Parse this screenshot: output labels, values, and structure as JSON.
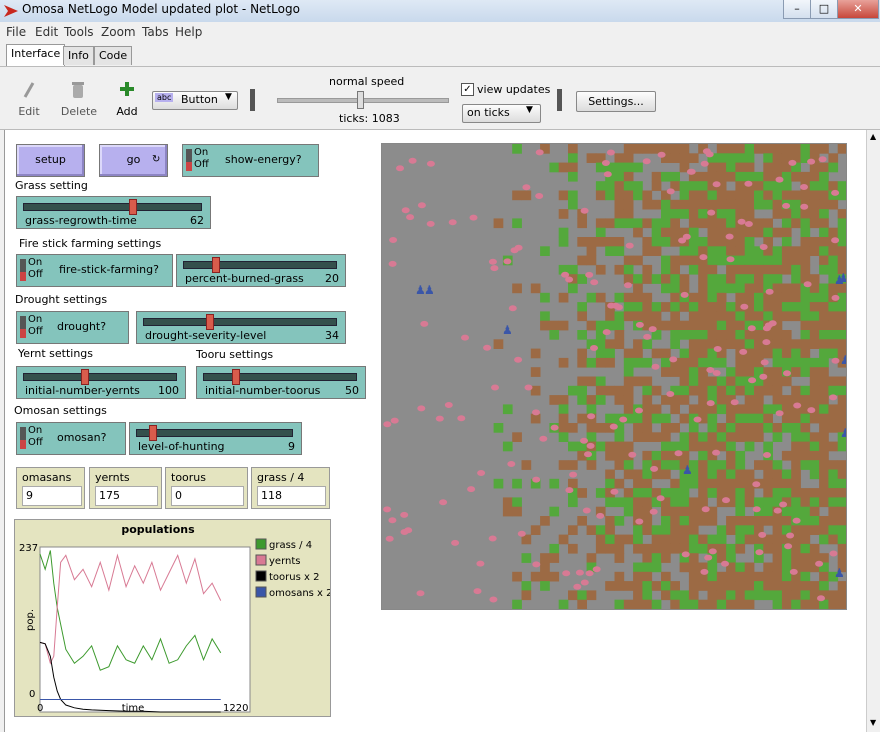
{
  "window": {
    "title": "Omosa NetLogo Model updated plot - NetLogo"
  },
  "menu": [
    "File",
    "Edit",
    "Tools",
    "Zoom",
    "Tabs",
    "Help"
  ],
  "tabs": [
    "Interface",
    "Info",
    "Code"
  ],
  "toolbar": {
    "edit": "Edit",
    "delete": "Delete",
    "add": "Add",
    "widget_type": "Button",
    "speed_label": "normal speed",
    "ticks": "ticks: 1083",
    "view_updates": "view updates",
    "update_mode": "on ticks",
    "settings": "Settings..."
  },
  "buttons": {
    "setup": "setup",
    "go": "go"
  },
  "switches": {
    "on": "On",
    "off": "Off",
    "show_energy": "show-energy?",
    "fire_stick": "fire-stick-farming?",
    "drought": "drought?",
    "omosan": "omosan?"
  },
  "notes": {
    "grass": "Grass setting",
    "fire": "Fire stick farming settings",
    "drought": "Drought settings",
    "yernt": "Yernt settings",
    "tooru": "Tooru settings",
    "omosan": "Omosan settings"
  },
  "sliders": {
    "grass_regrowth": {
      "label": "grass-regrowth-time",
      "value": "62",
      "fraction": 0.62
    },
    "percent_burned": {
      "label": "percent-burned-grass",
      "value": "20",
      "fraction": 0.2
    },
    "drought_severity": {
      "label": "drought-severity-level",
      "value": "34",
      "fraction": 0.34
    },
    "yernts": {
      "label": "initial-number-yernts",
      "value": "100",
      "fraction": 0.4
    },
    "toorus": {
      "label": "initial-number-toorus",
      "value": "50",
      "fraction": 0.2
    },
    "hunting": {
      "label": "level-of-hunting",
      "value": "9",
      "fraction": 0.09
    }
  },
  "monitors": [
    {
      "label": "omasans",
      "value": "9"
    },
    {
      "label": "yernts",
      "value": "175"
    },
    {
      "label": "toorus",
      "value": "0"
    },
    {
      "label": "grass / 4",
      "value": "118"
    }
  ],
  "colors": {
    "grass": "#54a83c",
    "yernts": "#d87a94",
    "toorus": "#000000",
    "omosans": "#3a56a8",
    "dirt": "#9c6a44",
    "ground": "#8c8c8c"
  },
  "chart_data": {
    "type": "line",
    "title": "populations",
    "xlabel": "time",
    "ylabel": "pop.",
    "xlim": [
      0,
      1220
    ],
    "ylim": [
      0,
      237
    ],
    "x_tick_labels": [
      "0",
      "1220"
    ],
    "y_tick_labels": [
      "0",
      "237"
    ],
    "legend_position": "right",
    "series": [
      {
        "name": "grass / 4",
        "color": "#3d9a2e",
        "x": [
          0,
          30,
          60,
          80,
          100,
          150,
          200,
          250,
          300,
          350,
          400,
          450,
          500,
          550,
          600,
          650,
          700,
          750,
          800,
          850,
          900,
          950,
          1000,
          1050
        ],
        "y": [
          227,
          205,
          232,
          185,
          150,
          90,
          70,
          80,
          95,
          60,
          65,
          95,
          75,
          70,
          95,
          75,
          105,
          70,
          75,
          95,
          110,
          75,
          105,
          85
        ]
      },
      {
        "name": "yernts",
        "color": "#d87a94",
        "x": [
          0,
          30,
          60,
          80,
          100,
          120,
          150,
          200,
          250,
          300,
          350,
          400,
          450,
          500,
          550,
          600,
          650,
          700,
          750,
          800,
          850,
          900,
          950,
          1000,
          1050
        ],
        "y": [
          100,
          98,
          70,
          80,
          150,
          215,
          225,
          190,
          205,
          180,
          215,
          175,
          225,
          180,
          210,
          185,
          215,
          175,
          200,
          225,
          185,
          220,
          170,
          185,
          160
        ]
      },
      {
        "name": "toorus x 2",
        "color": "#000000",
        "x": [
          0,
          30,
          60,
          80,
          100,
          120,
          150,
          200,
          250,
          300,
          400,
          500,
          600,
          700,
          800,
          900,
          1000,
          1050
        ],
        "y": [
          100,
          98,
          80,
          50,
          30,
          18,
          10,
          6,
          4,
          3,
          2,
          1,
          1,
          0,
          0,
          0,
          0,
          0
        ]
      },
      {
        "name": "omosans x 2",
        "color": "#3a56a8",
        "x": [
          0,
          100,
          200,
          300,
          400,
          500,
          600,
          700,
          800,
          900,
          1000,
          1050
        ],
        "y": [
          18,
          18,
          18,
          18,
          18,
          18,
          18,
          18,
          18,
          18,
          18,
          18
        ]
      }
    ]
  }
}
